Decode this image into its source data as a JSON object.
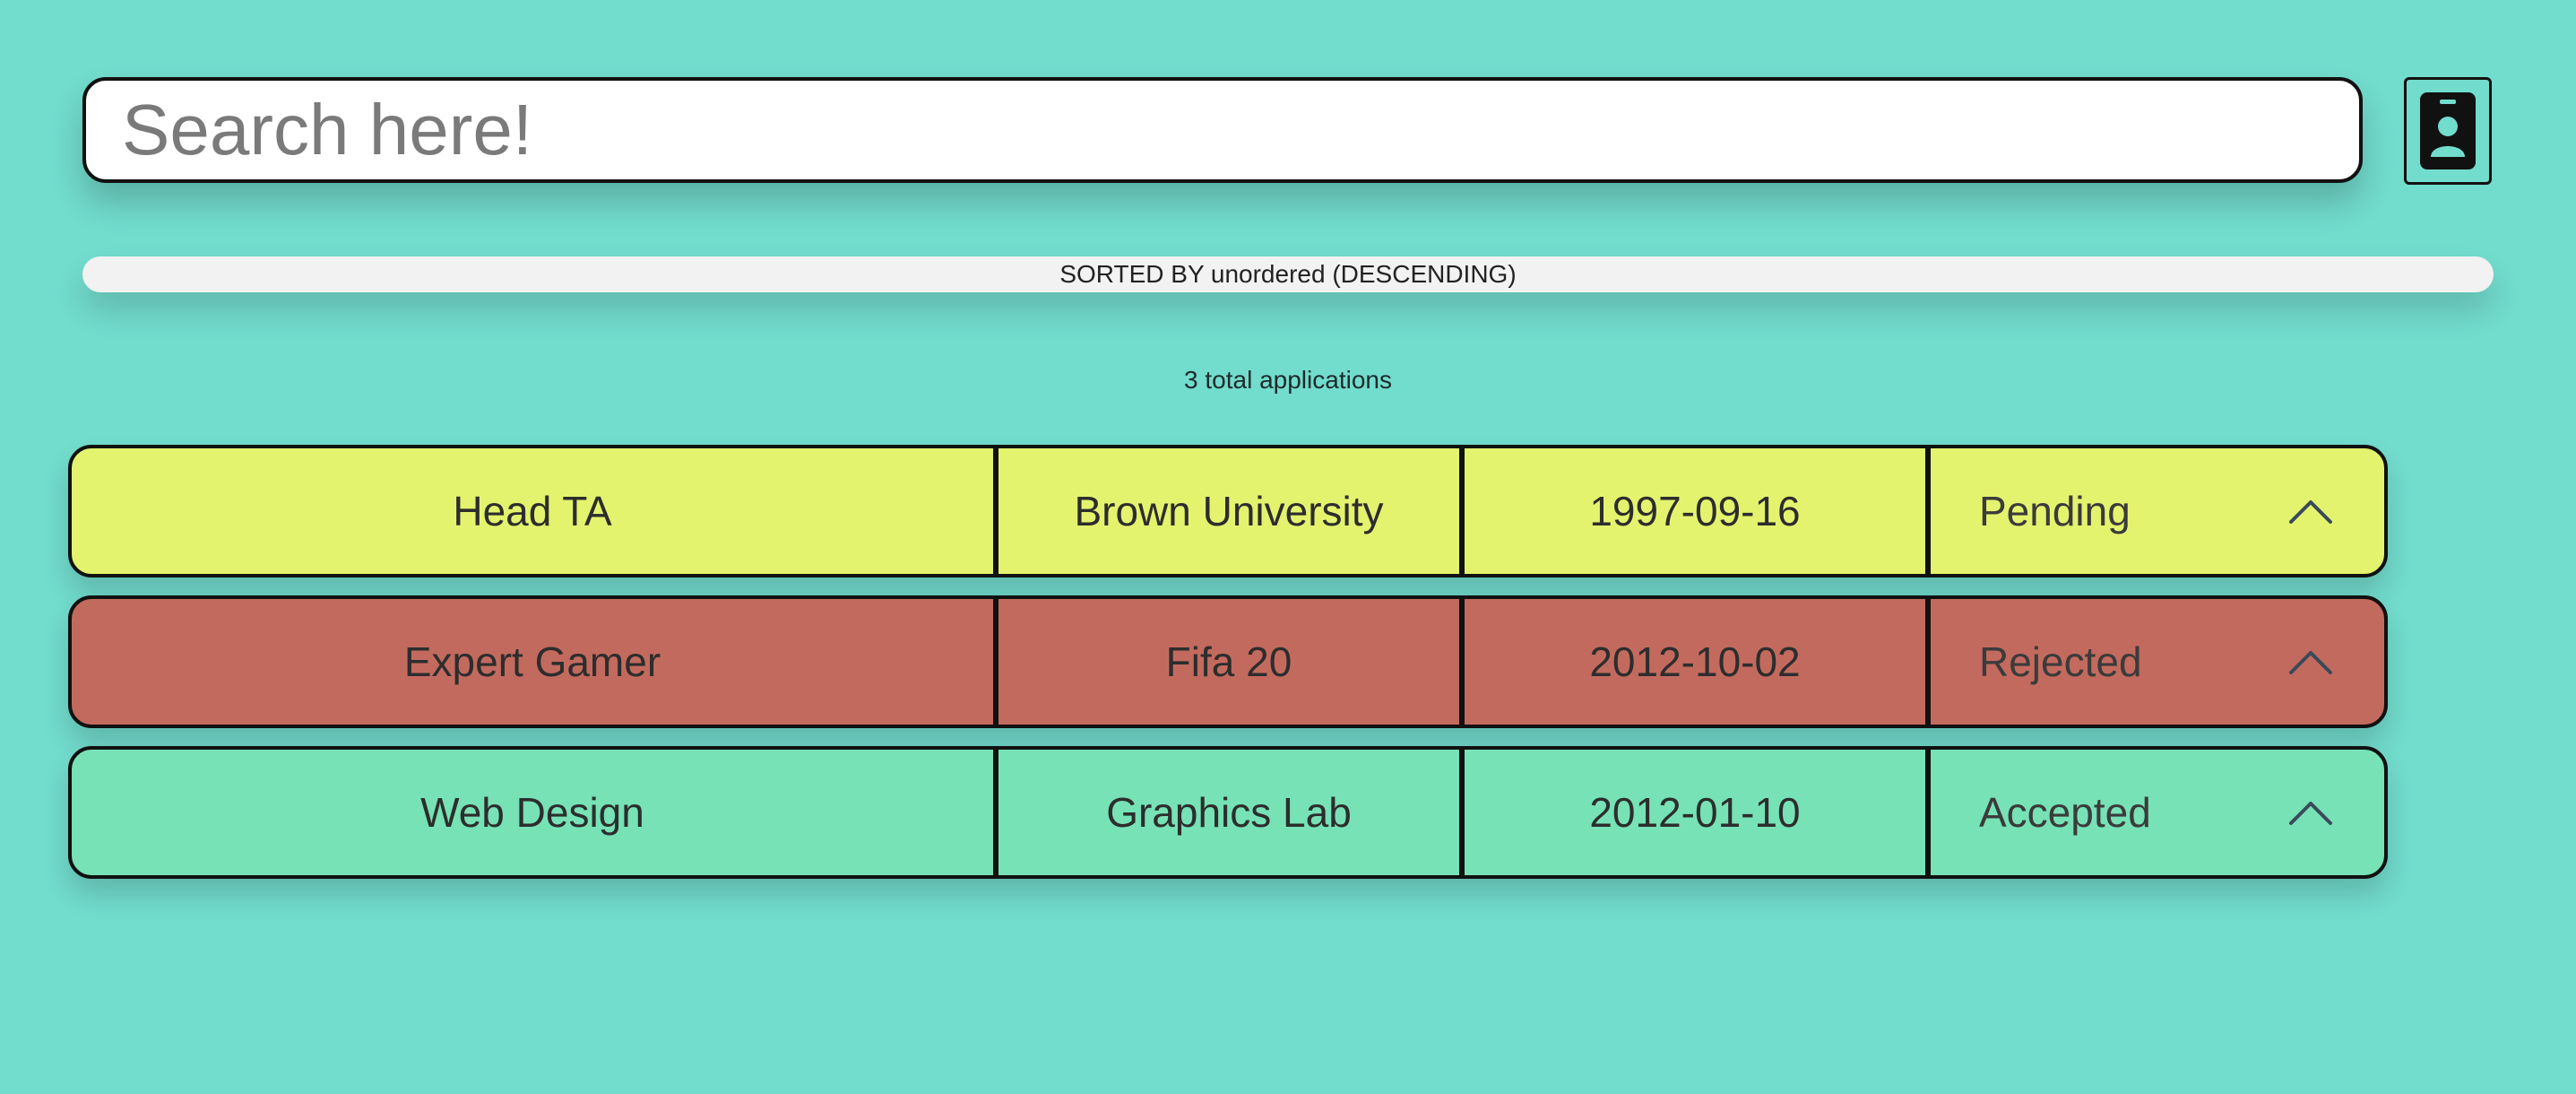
{
  "search": {
    "placeholder": "Search here!",
    "value": ""
  },
  "profile_button": {
    "icon": "id-badge-icon"
  },
  "sort_bar": {
    "label": "SORTED BY unordered (DESCENDING)"
  },
  "total": {
    "label": "3 total applications"
  },
  "applications": [
    {
      "title": "Head TA",
      "organization": "Brown University",
      "date": "1997-09-16",
      "status": "Pending",
      "color": "#e4f36e",
      "icon": "chevron-up-icon"
    },
    {
      "title": "Expert Gamer",
      "organization": "Fifa 20",
      "date": "2012-10-02",
      "status": "Rejected",
      "color": "#c36a5e",
      "icon": "chevron-up-icon"
    },
    {
      "title": "Web Design",
      "organization": "Graphics Lab",
      "date": "2012-01-10",
      "status": "Accepted",
      "color": "#76e2b6",
      "icon": "chevron-up-icon"
    }
  ],
  "colors": {
    "background": "#72dccd",
    "search_bg": "#ffffff",
    "sort_bar_bg": "#f2f2f2",
    "border": "#111111"
  }
}
